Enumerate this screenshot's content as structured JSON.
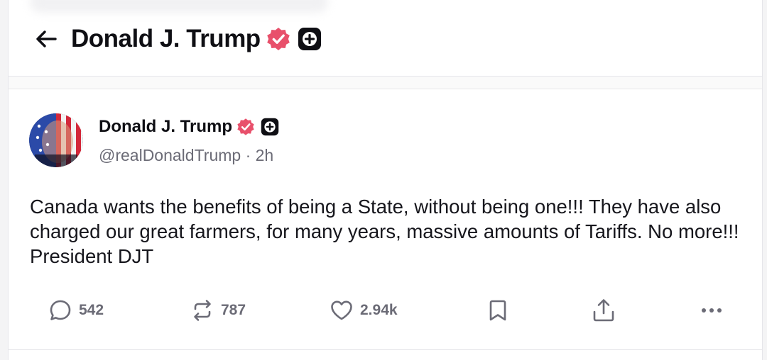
{
  "header": {
    "title": "Donald J. Trump",
    "back_icon": "arrow-left-icon",
    "verified_icon": "verified-badge-icon",
    "plus_icon": "plus-badge-icon"
  },
  "post": {
    "author_name": "Donald J. Trump",
    "handle": "@realDonaldTrump",
    "separator": "·",
    "time": "2h",
    "text": "Canada wants the benefits of being a State, without being one!!! They have also charged our great farmers, for many years, massive amounts of Tariffs. No more!!! President DJT",
    "actions": {
      "replies": "542",
      "retruths": "787",
      "likes": "2.94k"
    }
  },
  "colors": {
    "verified": "#e8506b",
    "text": "#0f0f14",
    "muted": "#6b6b76"
  }
}
